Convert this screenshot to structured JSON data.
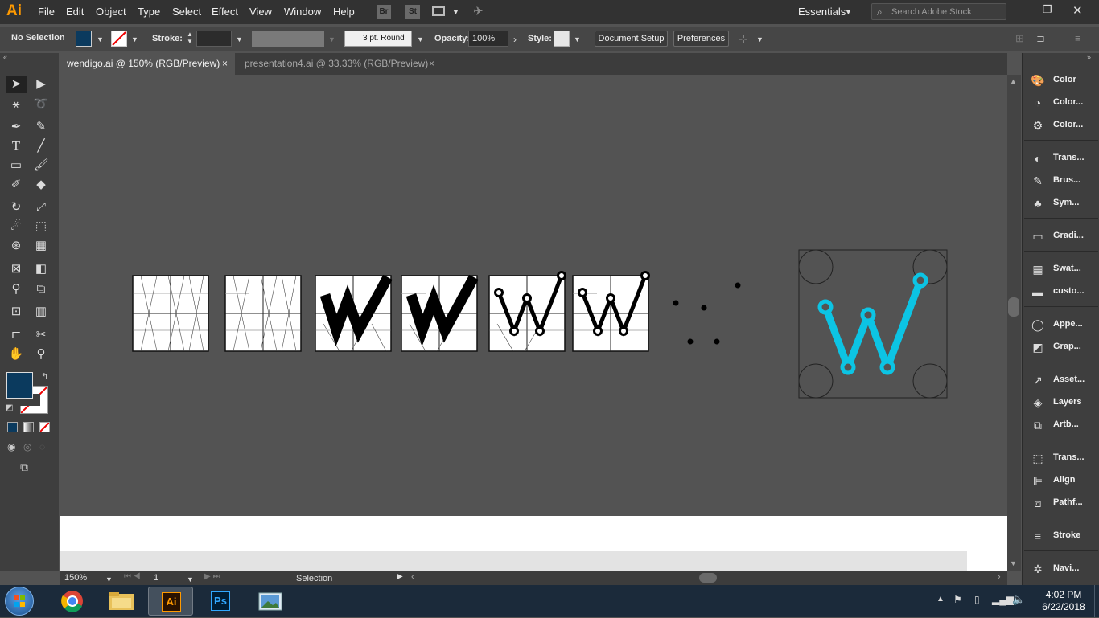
{
  "app": {
    "logo": "Ai"
  },
  "menu": [
    "File",
    "Edit",
    "Object",
    "Type",
    "Select",
    "Effect",
    "View",
    "Window",
    "Help"
  ],
  "menu_icons": {
    "bridge": "Br",
    "stock": "St"
  },
  "workspace": "Essentials",
  "search": {
    "placeholder": "Search Adobe Stock"
  },
  "control": {
    "selection": "No Selection",
    "fill_color": "#0b3a5e",
    "stroke_label": "Stroke:",
    "brush": "3 pt. Round",
    "opacity_label": "Opacity:",
    "opacity_value": "100%",
    "style_label": "Style:",
    "document_setup": "Document Setup",
    "preferences": "Preferences"
  },
  "tabs": [
    {
      "label": "wendigo.ai @ 150% (RGB/Preview)",
      "close": "×"
    },
    {
      "label": "presentation4.ai @ 33.33% (RGB/Preview)",
      "close": "×"
    }
  ],
  "status": {
    "zoom": "150%",
    "artboard": "1",
    "tool": "Selection"
  },
  "panels": [
    {
      "label": "Color",
      "icon": "color-palette-icon"
    },
    {
      "label": "Color...",
      "icon": "color-guide-icon"
    },
    {
      "label": "Color...",
      "icon": "color-themes-icon"
    },
    {
      "label": "Trans...",
      "icon": "transparency-icon"
    },
    {
      "label": "Brus...",
      "icon": "brushes-icon"
    },
    {
      "label": "Sym...",
      "icon": "symbols-icon"
    },
    {
      "label": "Gradi...",
      "icon": "gradient-icon"
    },
    {
      "label": "Swat...",
      "icon": "swatches-icon"
    },
    {
      "label": "custo...",
      "icon": "folder-icon"
    },
    {
      "label": "Appe...",
      "icon": "appearance-icon"
    },
    {
      "label": "Grap...",
      "icon": "graphic-styles-icon"
    },
    {
      "label": "Asset...",
      "icon": "asset-export-icon"
    },
    {
      "label": "Layers",
      "icon": "layers-icon"
    },
    {
      "label": "Artb...",
      "icon": "artboards-icon"
    },
    {
      "label": "Trans...",
      "icon": "transform-icon"
    },
    {
      "label": "Align",
      "icon": "align-icon"
    },
    {
      "label": "Pathf...",
      "icon": "pathfinder-icon"
    },
    {
      "label": "Stroke",
      "icon": "stroke-icon"
    },
    {
      "label": "Navi...",
      "icon": "navigator-icon"
    }
  ],
  "taskbar": {
    "apps": [
      "chrome",
      "explorer",
      "illustrator",
      "photoshop",
      "photos"
    ],
    "ai_label": "Ai",
    "ps_label": "Ps",
    "time": "4:02 PM",
    "date": "6/22/2018"
  },
  "colors": {
    "accent_cyan": "#0cc4e4",
    "fill": "#0b3a5e"
  }
}
